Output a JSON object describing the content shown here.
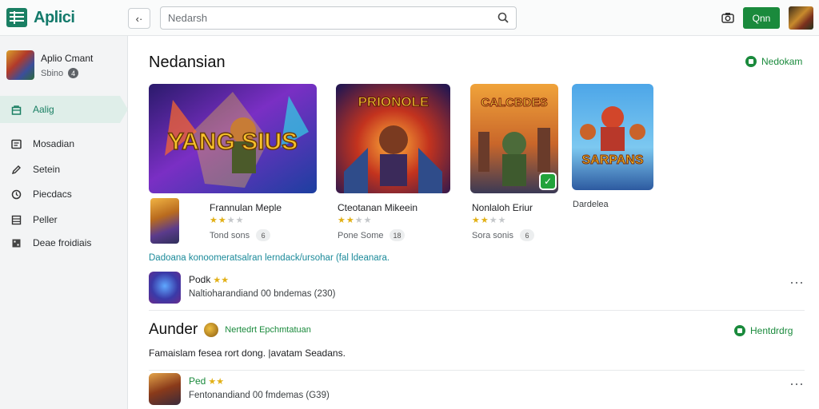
{
  "app": {
    "title": "Aplici"
  },
  "search": {
    "placeholder": "Nedarsh"
  },
  "header": {
    "primary_button": "Qnn"
  },
  "profile": {
    "name": "Aplio Cmant",
    "sub": "Sbino",
    "badge": "4"
  },
  "sidebar": {
    "items": [
      {
        "label": "Aalig",
        "icon": "bag-icon",
        "active": true
      },
      {
        "label": "Mosadian",
        "icon": "chat-icon",
        "active": false
      },
      {
        "label": "Setein",
        "icon": "pen-icon",
        "active": false
      },
      {
        "label": "Piecdacs",
        "icon": "clock-icon",
        "active": false
      },
      {
        "label": "Peller",
        "icon": "grid-icon",
        "active": false
      },
      {
        "label": "Deae froidiais",
        "icon": "dice-icon",
        "active": false
      }
    ]
  },
  "section1": {
    "title": "Nedansian",
    "link": "Nedokam",
    "cards": [
      {
        "title": "Frannulan Meple",
        "rating": 2,
        "meta": "Tond sons",
        "pill": "6"
      },
      {
        "title": "Cteotanan Mikeein",
        "rating": 2,
        "meta": "Pone Some",
        "pill": "18"
      },
      {
        "title": "Nonlaloh Eriur",
        "rating": 2,
        "meta": "Sora sonis",
        "pill": "6"
      },
      {
        "title": "Dardelea"
      }
    ],
    "art_text": {
      "a": "YANG SIUS",
      "b": "PRIONOLE",
      "c": "CALCBDES",
      "d": "SARPANS"
    },
    "note": "Dadoana konoomeratsalran lerndack/ursohar (fal ldeanara."
  },
  "list1": {
    "title": "Podk",
    "rating": 2,
    "sub": "Naltioharandiand 00 bndemas (230)"
  },
  "section2": {
    "title": "Aunder",
    "sub": "Nertedrt Epchmtatuan",
    "link": "Hentdrdrg",
    "desc": "Famaislam fesea rort dong. |avatam Seadans."
  },
  "list2": {
    "title": "Ped",
    "rating": 2,
    "sub": "Fentonandiand 00 fmdemas (G39)"
  },
  "colors": {
    "accent": "#1a8a3c",
    "brand": "#147a6b",
    "teal_text": "#1b8a9a",
    "star": "#e2b016"
  }
}
